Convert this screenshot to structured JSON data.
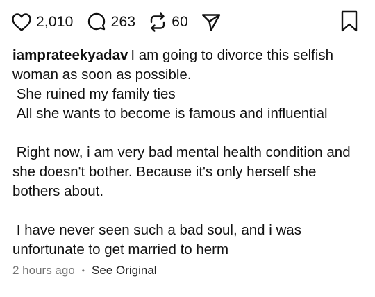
{
  "actions": {
    "likes": "2,010",
    "comments": "263",
    "reposts": "60",
    "icons": [
      "heart-icon",
      "comment-icon",
      "repost-icon",
      "share-icon",
      "bookmark-icon"
    ]
  },
  "caption": {
    "username": "iamprateekyadav",
    "first_line": "I am going to divorce this selfish woman as soon as possible.",
    "lines_block1": [
      " She ruined my family ties",
      " All she wants to become is famous and influential"
    ],
    "paragraph2": " Right now, i am very bad mental health condition and she doesn't bother. Because it's only herself she bothers about.",
    "paragraph3": " I have never seen such a bad soul, and i was unfortunate to get married to herm"
  },
  "meta": {
    "time": "2 hours ago",
    "separator": "•",
    "see_original": "See Original"
  }
}
